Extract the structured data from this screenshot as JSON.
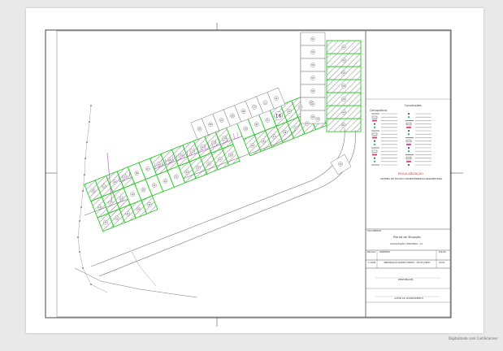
{
  "colors": {
    "lot_outline": "#2bcb2b",
    "hatch": "#555555",
    "ruler": "#b06cc0",
    "line": "#777777",
    "title_accent": "#c0392b"
  },
  "map": {
    "big_lot_label": "16",
    "lots_main": [
      "02",
      "03",
      "04",
      "05",
      "06",
      "07",
      "08",
      "09",
      "10",
      "11",
      "12",
      "13",
      "14",
      "15",
      "17",
      "18",
      "19",
      "20",
      "21",
      "22",
      "23",
      "24",
      "25",
      "26",
      "27",
      "28",
      "29",
      "30",
      "31",
      "32",
      "33",
      "34",
      "35",
      "36",
      "37",
      "38"
    ],
    "lots_top": [
      "51",
      "52",
      "53",
      "54",
      "55",
      "56",
      "57",
      "58",
      "59",
      "60",
      "61",
      "62",
      "63",
      "64"
    ],
    "lots_left": [
      "40",
      "41",
      "42",
      "43",
      "44",
      "45",
      "46",
      "47",
      "48"
    ]
  },
  "legend": {
    "title": "Convenções",
    "subtitle": "Cartográficas"
  },
  "title_block": {
    "project_title": "REGULARIZAÇÃO",
    "project_subtitle": "SISTEMA DE ESTUDO GEOREFERENCIAL/PARAMETRIZA",
    "plan_label": "Planta de Situação",
    "plan_sub": "LOCALIZAÇÃO CONCURSO - A1",
    "scale_label": "ESCALA",
    "scale_value": "1:1000",
    "drawing_label": "DESENHO",
    "drawing_value": "URBANIZAÇÃO BAIRRO CENTRO - MG DE JUNHO",
    "sheet_label": "FOLHA",
    "sheet_value": "01/01",
    "resp1": "RESPONSÁVEL",
    "resp2": "AUTOR DO LEVANTAMENTO",
    "header_small": "DOCUMENTO"
  },
  "caption": "Digitalizado com CamScanner"
}
